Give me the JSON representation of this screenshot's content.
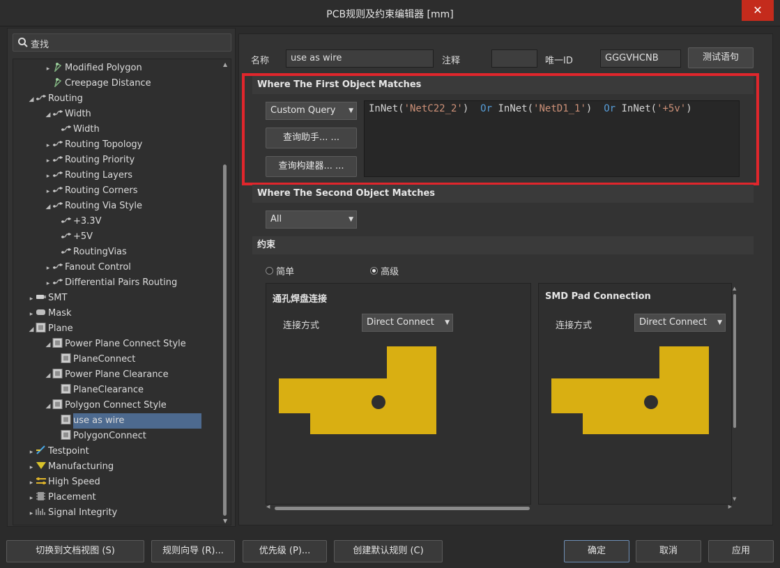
{
  "window": {
    "title": "PCB规则及约束编辑器 [mm]"
  },
  "search": {
    "placeholder": "查找"
  },
  "tree": {
    "items": [
      {
        "label": "Modified Polygon",
        "arrow": "▸",
        "icon": "polygon-icon"
      },
      {
        "label": "Creepage Distance",
        "arrow": "",
        "icon": "polygon-icon"
      },
      {
        "label": "Routing",
        "arrow": "◢",
        "icon": "routing-icon"
      },
      {
        "label": "Width",
        "arrow": "◢",
        "icon": "routing-icon"
      },
      {
        "label": "Width",
        "arrow": "",
        "icon": "routing-icon"
      },
      {
        "label": "Routing Topology",
        "arrow": "▸",
        "icon": "routing-icon"
      },
      {
        "label": "Routing Priority",
        "arrow": "▸",
        "icon": "routing-icon"
      },
      {
        "label": "Routing Layers",
        "arrow": "▸",
        "icon": "routing-icon"
      },
      {
        "label": "Routing Corners",
        "arrow": "▸",
        "icon": "routing-icon"
      },
      {
        "label": "Routing Via Style",
        "arrow": "◢",
        "icon": "routing-icon"
      },
      {
        "label": "+3.3V",
        "arrow": "",
        "icon": "routing-icon"
      },
      {
        "label": "+5V",
        "arrow": "",
        "icon": "routing-icon"
      },
      {
        "label": "RoutingVias",
        "arrow": "",
        "icon": "routing-icon"
      },
      {
        "label": "Fanout Control",
        "arrow": "▸",
        "icon": "routing-icon"
      },
      {
        "label": "Differential Pairs Routing",
        "arrow": "▸",
        "icon": "routing-icon"
      },
      {
        "label": "SMT",
        "arrow": "▸",
        "icon": "smt-icon"
      },
      {
        "label": "Mask",
        "arrow": "▸",
        "icon": "mask-icon"
      },
      {
        "label": "Plane",
        "arrow": "◢",
        "icon": "plane-icon"
      },
      {
        "label": "Power Plane Connect Style",
        "arrow": "◢",
        "icon": "plane-icon"
      },
      {
        "label": "PlaneConnect",
        "arrow": "",
        "icon": "plane-icon"
      },
      {
        "label": "Power Plane Clearance",
        "arrow": "◢",
        "icon": "plane-icon"
      },
      {
        "label": "PlaneClearance",
        "arrow": "",
        "icon": "plane-icon"
      },
      {
        "label": "Polygon Connect Style",
        "arrow": "◢",
        "icon": "plane-icon"
      },
      {
        "label": "use as wire",
        "arrow": "",
        "icon": "plane-icon"
      },
      {
        "label": "PolygonConnect",
        "arrow": "",
        "icon": "plane-icon"
      },
      {
        "label": "Testpoint",
        "arrow": "▸",
        "icon": "testpoint-icon"
      },
      {
        "label": "Manufacturing",
        "arrow": "▸",
        "icon": "manufacturing-icon"
      },
      {
        "label": "High Speed",
        "arrow": "▸",
        "icon": "highspeed-icon"
      },
      {
        "label": "Placement",
        "arrow": "▸",
        "icon": "placement-icon"
      },
      {
        "label": "Signal Integrity",
        "arrow": "▸",
        "icon": "signal-icon"
      }
    ]
  },
  "rule": {
    "name_label": "名称",
    "name_value": "use as wire",
    "comment_label": "注释",
    "comment_value": "",
    "uid_label": "唯一ID",
    "uid_value": "GGGVHCNB",
    "test_button": "测试语句"
  },
  "first_match": {
    "header": "Where The First Object Matches",
    "dropdown": "Custom Query",
    "helper_button": "查询助手... ...",
    "builder_button": "查询构建器... ...",
    "query": {
      "fn1": "InNet(",
      "arg1": "'NetC22_2'",
      "close1": ")",
      "or1": "Or",
      "fn2": "InNet(",
      "arg2": "'NetD1_1'",
      "close2": ")",
      "or2": "Or",
      "fn3": "InNet(",
      "arg3": "'+5v'",
      "close3": ")"
    }
  },
  "second_match": {
    "header": "Where The Second Object Matches",
    "dropdown": "All"
  },
  "constraints": {
    "header": "约束",
    "simple_label": "简单",
    "advanced_label": "高级",
    "mode": "advanced",
    "pad_shape_color": "#d9af12",
    "via_card": {
      "title": "通孔焊盘连接",
      "method_label": "连接方式",
      "method_value": "Direct Connect"
    },
    "smd_card": {
      "title": "SMD Pad Connection",
      "method_label": "连接方式",
      "method_value": "Direct Connect"
    }
  },
  "footer": {
    "doc_view": "切换到文档视图 (S)",
    "wizard": "规则向导 (R)...",
    "priority": "优先级 (P)...",
    "create_default": "创建默认规则 (C)",
    "ok": "确定",
    "cancel": "取消",
    "apply": "应用"
  }
}
